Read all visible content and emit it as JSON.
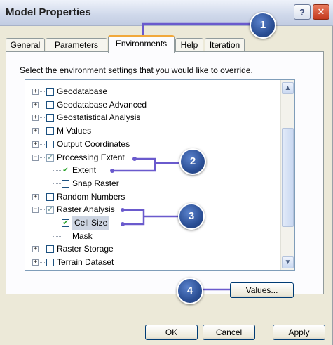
{
  "window": {
    "title": "Model Properties",
    "help_glyph": "?",
    "close_glyph": "✕"
  },
  "tabs": [
    {
      "label": "General"
    },
    {
      "label": "Parameters"
    },
    {
      "label": "Environments",
      "active": true
    },
    {
      "label": "Help"
    },
    {
      "label": "Iteration"
    }
  ],
  "prompt": "Select the environment settings that you would like to override.",
  "tree": {
    "items": [
      {
        "label": "Geodatabase",
        "expander": "+",
        "checked": false
      },
      {
        "label": "Geodatabase Advanced",
        "expander": "+",
        "checked": false
      },
      {
        "label": "Geostatistical Analysis",
        "expander": "+",
        "checked": false
      },
      {
        "label": "M Values",
        "expander": "+",
        "checked": false
      },
      {
        "label": "Output Coordinates",
        "expander": "+",
        "checked": false
      },
      {
        "label": "Processing Extent",
        "expander": "−",
        "checked": "partial"
      },
      {
        "label": "Extent",
        "child": true,
        "checked": true
      },
      {
        "label": "Snap Raster",
        "child": true,
        "checked": false
      },
      {
        "label": "Random Numbers",
        "expander": "+",
        "checked": false
      },
      {
        "label": "Raster Analysis",
        "expander": "−",
        "checked": "partial"
      },
      {
        "label": "Cell Size",
        "child": true,
        "checked": true,
        "highlighted": true
      },
      {
        "label": "Mask",
        "child": true,
        "checked": false
      },
      {
        "label": "Raster Storage",
        "expander": "+",
        "checked": false
      },
      {
        "label": "Terrain Dataset",
        "expander": "+",
        "checked": false
      }
    ],
    "scroll_up_glyph": "▲",
    "scroll_down_glyph": "▼",
    "check_glyph": "✔"
  },
  "buttons": {
    "values": "Values...",
    "ok": "OK",
    "cancel": "Cancel",
    "apply": "Apply"
  },
  "callouts": [
    "1",
    "2",
    "3",
    "4"
  ],
  "colors": {
    "callout": "#2b4f95",
    "connector": "#6a5acd",
    "active_tab_accent": "#f1a83a"
  }
}
